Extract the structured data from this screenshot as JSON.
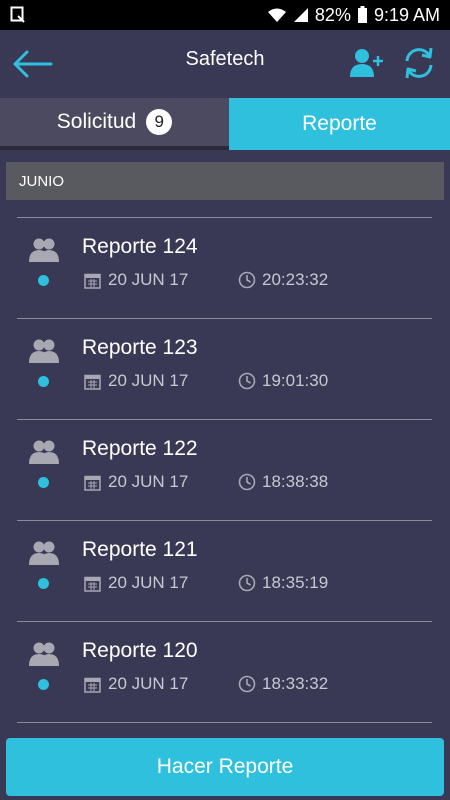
{
  "status_bar": {
    "battery": "82%",
    "time": "9:19 AM"
  },
  "app_bar": {
    "title": "Safetech"
  },
  "tabs": [
    {
      "label": "Solicitud",
      "badge": "9",
      "selected": false
    },
    {
      "label": "Reporte",
      "selected": true
    }
  ],
  "section": {
    "label": "JUNIO"
  },
  "reports": [
    {
      "title": "Reporte 124",
      "date": "20 JUN 17",
      "time": "20:23:32"
    },
    {
      "title": "Reporte 123",
      "date": "20 JUN 17",
      "time": "19:01:30"
    },
    {
      "title": "Reporte 122",
      "date": "20 JUN 17",
      "time": "18:38:38"
    },
    {
      "title": "Reporte 121",
      "date": "20 JUN 17",
      "time": "18:35:19"
    },
    {
      "title": "Reporte 120",
      "date": "20 JUN 17",
      "time": "18:33:32"
    }
  ],
  "cta": {
    "label": "Hacer Reporte"
  },
  "colors": {
    "background": "#3a3955",
    "accent": "#2fc0dd",
    "header_bg": "#595960"
  }
}
